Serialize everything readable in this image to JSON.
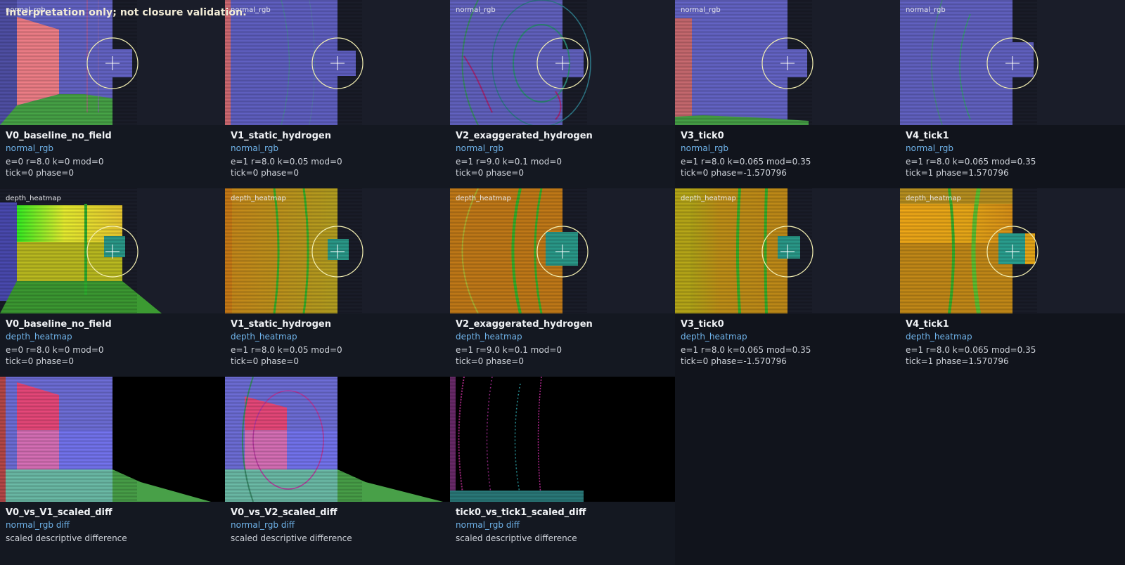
{
  "banner": "Interpretation only; not closure validation.",
  "rows": [
    [
      {
        "tag": "normal_rgb",
        "title": "V0_baseline_no_field",
        "mode": "normal_rgb",
        "line1": "e=0 r=8.0 k=0 mod=0",
        "line2": "tick=0 phase=0"
      },
      {
        "tag": "normal_rgb",
        "title": "V1_static_hydrogen",
        "mode": "normal_rgb",
        "line1": "e=1 r=8.0 k=0.05 mod=0",
        "line2": "tick=0 phase=0"
      },
      {
        "tag": "normal_rgb",
        "title": "V2_exaggerated_hydrogen",
        "mode": "normal_rgb",
        "line1": "e=1 r=9.0 k=0.1 mod=0",
        "line2": "tick=0 phase=0"
      },
      {
        "tag": "normal_rgb",
        "title": "V3_tick0",
        "mode": "normal_rgb",
        "line1": "e=1 r=8.0 k=0.065 mod=0.35",
        "line2": "tick=0 phase=-1.570796"
      },
      {
        "tag": "normal_rgb",
        "title": "V4_tick1",
        "mode": "normal_rgb",
        "line1": "e=1 r=8.0 k=0.065 mod=0.35",
        "line2": "tick=1 phase=1.570796"
      }
    ],
    [
      {
        "tag": "depth_heatmap",
        "title": "V0_baseline_no_field",
        "mode": "depth_heatmap",
        "line1": "e=0 r=8.0 k=0 mod=0",
        "line2": "tick=0 phase=0"
      },
      {
        "tag": "depth_heatmap",
        "title": "V1_static_hydrogen",
        "mode": "depth_heatmap",
        "line1": "e=1 r=8.0 k=0.05 mod=0",
        "line2": "tick=0 phase=0"
      },
      {
        "tag": "depth_heatmap",
        "title": "V2_exaggerated_hydrogen",
        "mode": "depth_heatmap",
        "line1": "e=1 r=9.0 k=0.1 mod=0",
        "line2": "tick=0 phase=0"
      },
      {
        "tag": "depth_heatmap",
        "title": "V3_tick0",
        "mode": "depth_heatmap",
        "line1": "e=1 r=8.0 k=0.065 mod=0.35",
        "line2": "tick=0 phase=-1.570796"
      },
      {
        "tag": "depth_heatmap",
        "title": "V4_tick1",
        "mode": "depth_heatmap",
        "line1": "e=1 r=8.0 k=0.065 mod=0.35",
        "line2": "tick=1 phase=1.570796"
      }
    ],
    [
      {
        "title": "V0_vs_V1_scaled_diff",
        "mode": "normal_rgb diff",
        "line1": "scaled descriptive difference"
      },
      {
        "title": "V0_vs_V2_scaled_diff",
        "mode": "normal_rgb diff",
        "line1": "scaled descriptive difference"
      },
      {
        "title": "tick0_vs_tick1_scaled_diff",
        "mode": "normal_rgb diff",
        "line1": "scaled descriptive difference"
      }
    ]
  ],
  "colors": {
    "background": "#11141c",
    "panel": "#141821",
    "title_text": "#f0f2f5",
    "mode_text": "#6fb3ea",
    "param_text": "#cfd3da",
    "banner_text": "#f2ecd6",
    "reticle": "#f3efb2"
  }
}
